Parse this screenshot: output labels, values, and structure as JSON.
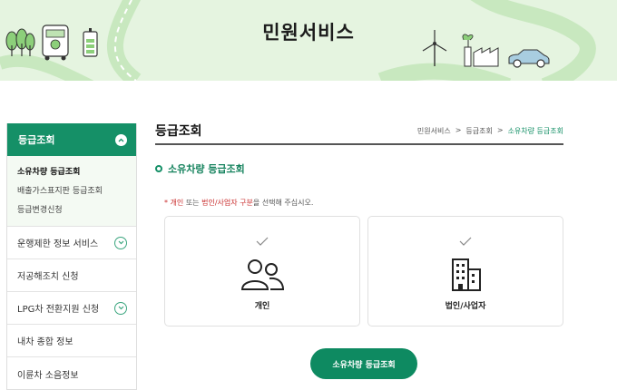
{
  "banner": {
    "title": "민원서비스"
  },
  "sidebar": {
    "active": "등급조회",
    "subitems": [
      "소유차량 등급조회",
      "배출가스표지판 등급조회",
      "등급변경신청"
    ],
    "items": [
      "운행제한 정보 서비스",
      "저공해조치 신청",
      "LPG차 전환지원 신청",
      "내차 종합 정보",
      "이륜차 소음정보"
    ]
  },
  "content": {
    "title": "등급조회",
    "breadcrumb": [
      "민원서비스",
      "등급조회",
      "소유차량 등급조회"
    ],
    "breadcrumb_sep": ">",
    "section_title": "소유차량 등급조회",
    "note": {
      "star": "*",
      "part1": "개인",
      "part2": " 또는 ",
      "part3": "법인/사업자 구분",
      "part4": "을 선택해 주십시오."
    },
    "cards": [
      {
        "label": "개인",
        "icon": "person-group-icon"
      },
      {
        "label": "법인/사업자",
        "icon": "building-icon"
      }
    ],
    "button": "소유차량 등급조회"
  },
  "colors": {
    "accent": "#159067",
    "banner_bg": "#e5f4e0"
  }
}
